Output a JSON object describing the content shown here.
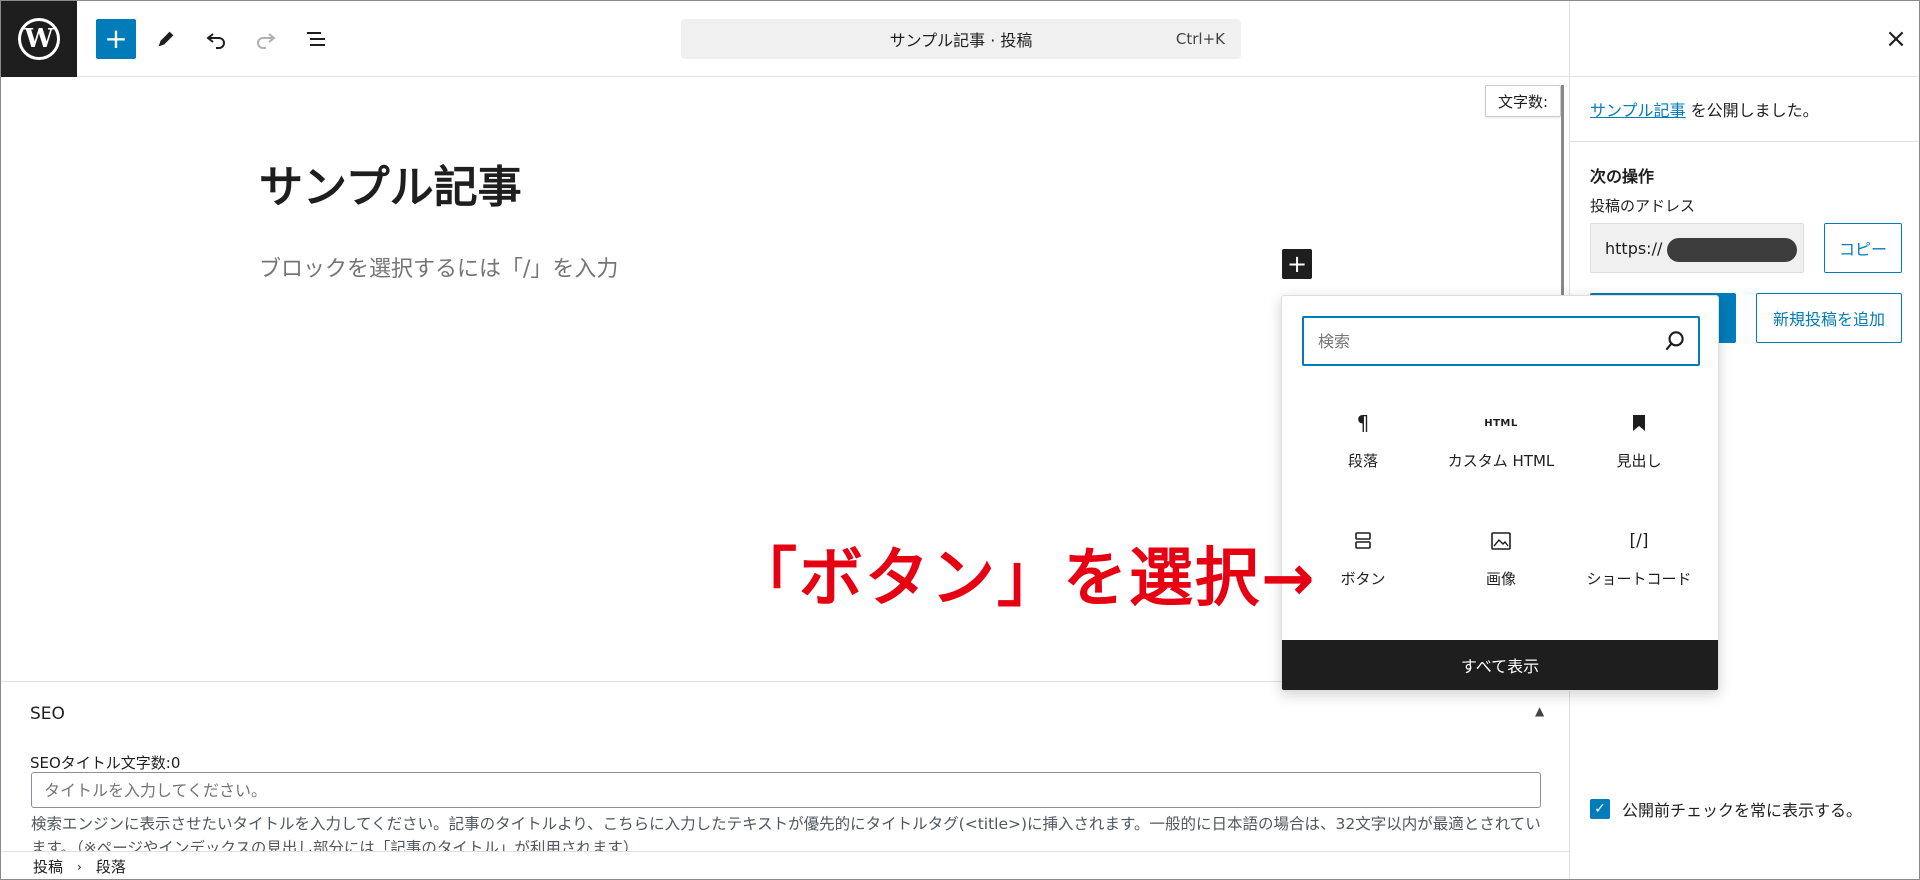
{
  "header": {
    "add_icon": "plus-icon",
    "tools_icon": "pencil-icon",
    "undo_icon": "undo-icon",
    "redo_icon": "redo-icon",
    "list_view_icon": "list-view-icon",
    "command_title": "サンプル記事 · 投稿",
    "command_shortcut": "Ctrl+K"
  },
  "editor": {
    "word_count_label": "文字数:",
    "post_title": "サンプル記事",
    "block_placeholder": "ブロックを選択するには「/」を入力"
  },
  "inserter": {
    "search_placeholder": "検索",
    "blocks": [
      {
        "label": "段落",
        "icon": "paragraph-icon",
        "glyph": "¶"
      },
      {
        "label": "カスタム HTML",
        "icon": "html-icon",
        "glyph": "HTML"
      },
      {
        "label": "見出し",
        "icon": "bookmark-icon",
        "glyph": "⯁"
      },
      {
        "label": "ボタン",
        "icon": "buttons-icon",
        "glyph": "⊟"
      },
      {
        "label": "画像",
        "icon": "image-icon",
        "glyph": "▣"
      },
      {
        "label": "ショートコード",
        "icon": "shortcode-icon",
        "glyph": "[/]"
      }
    ],
    "show_all_label": "すべて表示"
  },
  "annotation": {
    "text": "「ボタン」を選択→"
  },
  "seo": {
    "title": "SEO",
    "count_label": "SEOタイトル文字数:0",
    "input_placeholder": "タイトルを入力してください。",
    "help_text": "検索エンジンに表示させたいタイトルを入力してください。記事のタイトルより、こちらに入力したテキストが優先的にタイトルタグ(<title>)に挿入されます。一般的に日本語の場合は、32文字以内が最適とされています。（※ページやインデックスの見出し部分には「記事のタイトル」が利用されます）"
  },
  "breadcrumb": {
    "items": [
      "投稿",
      "段落"
    ]
  },
  "sidebar": {
    "published_link": "サンプル記事",
    "published_suffix": " を公開しました。",
    "next_steps": "次の操作",
    "address_label": "投稿のアドレス",
    "address_value": "https://",
    "copy_label": "コピー",
    "new_post_label": "新規投稿を追加",
    "precheck_label": "公開前チェックを常に表示する。"
  },
  "colors": {
    "accent": "#007cba",
    "dark": "#1e1e1e",
    "annotation": "#e60012"
  }
}
